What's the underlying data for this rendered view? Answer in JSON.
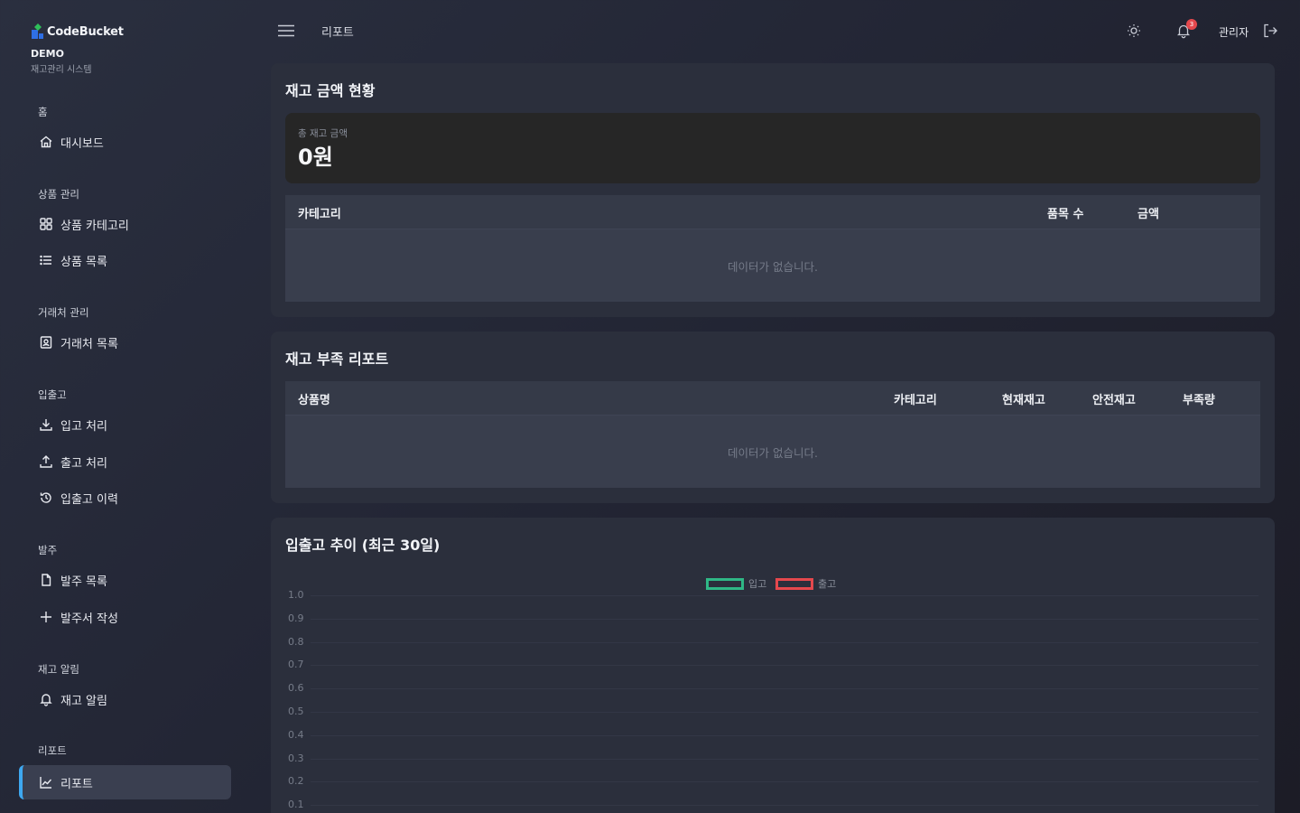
{
  "brand": {
    "name": "CodeBucket",
    "demo": "DEMO",
    "subtitle": "재고관리 시스템"
  },
  "sidebar": {
    "sections": [
      {
        "label": "홈",
        "items": [
          {
            "label": "대시보드",
            "icon": "home-icon"
          }
        ]
      },
      {
        "label": "상품 관리",
        "items": [
          {
            "label": "상품 카테고리",
            "icon": "grid-icon"
          },
          {
            "label": "상품 목록",
            "icon": "list-icon"
          }
        ]
      },
      {
        "label": "거래처 관리",
        "items": [
          {
            "label": "거래처 목록",
            "icon": "contacts-icon"
          }
        ]
      },
      {
        "label": "입출고",
        "items": [
          {
            "label": "입고 처리",
            "icon": "download-icon"
          },
          {
            "label": "출고 처리",
            "icon": "upload-icon"
          },
          {
            "label": "입출고 이력",
            "icon": "history-icon"
          }
        ]
      },
      {
        "label": "발주",
        "items": [
          {
            "label": "발주 목록",
            "icon": "file-icon"
          },
          {
            "label": "발주서 작성",
            "icon": "plus-icon"
          }
        ]
      },
      {
        "label": "재고 알림",
        "items": [
          {
            "label": "재고 알림",
            "icon": "bell-icon"
          }
        ]
      },
      {
        "label": "리포트",
        "items": [
          {
            "label": "리포트",
            "icon": "chart-line-icon",
            "active": true
          }
        ]
      }
    ]
  },
  "header": {
    "title": "리포트",
    "notification_count": "3",
    "user": "관리자"
  },
  "inventory_value": {
    "title": "재고 금액 현황",
    "total_label": "총 재고 금액",
    "total_value": "0원",
    "columns": [
      "카테고리",
      "품목 수",
      "금액"
    ],
    "empty_text": "데이터가 없습니다."
  },
  "shortage": {
    "title": "재고 부족 리포트",
    "columns": [
      "상품명",
      "카테고리",
      "현재재고",
      "안전재고",
      "부족량"
    ],
    "empty_text": "데이터가 없습니다."
  },
  "trend": {
    "title": "입출고 추이 (최근 30일)",
    "legend": [
      {
        "name": "입고",
        "color": "#2fb886"
      },
      {
        "name": "출고",
        "color": "#e5484d"
      }
    ]
  },
  "chart_data": {
    "type": "line",
    "title": "입출고 추이 (최근 30일)",
    "series": [
      {
        "name": "입고",
        "values": []
      },
      {
        "name": "출고",
        "values": []
      }
    ],
    "ylim": [
      0,
      1
    ],
    "yticks": [
      "1.0",
      "0.9",
      "0.8",
      "0.7",
      "0.6",
      "0.5",
      "0.4",
      "0.3",
      "0.2",
      "0.1"
    ],
    "legend_position": "top-center",
    "grid": true
  }
}
